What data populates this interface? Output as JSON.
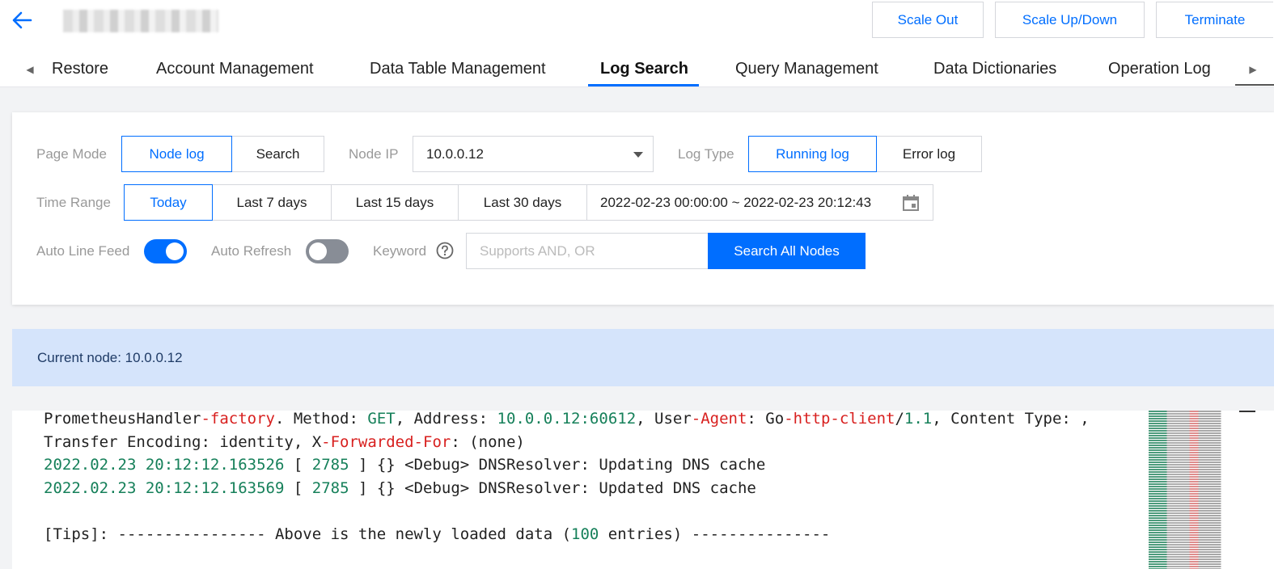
{
  "header": {
    "actions": [
      {
        "label": "Scale Out"
      },
      {
        "label": "Scale Up/Down"
      },
      {
        "label": "Terminate"
      }
    ],
    "tabs": [
      {
        "label": "Restore"
      },
      {
        "label": "Account Management"
      },
      {
        "label": "Data Table Management"
      },
      {
        "label": "Log Search",
        "active": true
      },
      {
        "label": "Query Management"
      },
      {
        "label": "Data Dictionaries"
      },
      {
        "label": "Operation Log"
      }
    ]
  },
  "filters": {
    "page_mode": {
      "label": "Page Mode",
      "options": [
        "Node log",
        "Search"
      ],
      "selected": "Node log"
    },
    "node_ip": {
      "label": "Node IP",
      "value": "10.0.0.12"
    },
    "log_type": {
      "label": "Log Type",
      "options": [
        "Running log",
        "Error log"
      ],
      "selected": "Running log"
    },
    "time_range": {
      "label": "Time Range",
      "options": [
        "Today",
        "Last 7 days",
        "Last 15 days",
        "Last 30 days"
      ],
      "selected": "Today",
      "value": "2022-02-23 00:00:00 ~ 2022-02-23 20:12:43"
    },
    "auto_line_feed": {
      "label": "Auto Line Feed",
      "on": true
    },
    "auto_refresh": {
      "label": "Auto Refresh",
      "on": false
    },
    "keyword": {
      "label": "Keyword",
      "placeholder": "Supports AND, OR",
      "value": ""
    },
    "search_button": "Search All Nodes"
  },
  "banner": {
    "text": "Current node: 10.0.0.12"
  },
  "log": {
    "line1": {
      "a": "PrometheusHandler",
      "b": "-factory",
      "c": ". Method: ",
      "d": "GET",
      "e": ", Address: ",
      "f": "10.0.0.12:60612",
      "g": ", User",
      "h": "-Agent",
      "i": ": Go",
      "j": "-http-client",
      "k": "/",
      "l": "1.1",
      "m": ", Content Type: ,"
    },
    "line2": {
      "a": "Transfer Encoding: identity, X",
      "b": "-Forwarded-For",
      "c": ": (none)"
    },
    "line3": {
      "ts": "2022.02.23 20:12:12.163526",
      "a": " [ ",
      "pid": "2785",
      "b": " ] {} <Debug> DNSResolver: Updating DNS cache"
    },
    "line4": {
      "ts": "2022.02.23 20:12:12.163569",
      "a": " [ ",
      "pid": "2785",
      "b": " ] {} <Debug> DNSResolver: Updated DNS cache"
    },
    "line6": {
      "a": "[Tips]: ---------------- Above is the newly loaded data (",
      "n": "100",
      "b": " entries) ---------------"
    }
  },
  "colors": {
    "accent": "#006eff",
    "log_red": "#d8201f",
    "log_green": "#16805a",
    "banner_bg": "#d5e4fb"
  },
  "icons": [
    "back-arrow-icon",
    "tab-scroll-left-icon",
    "tab-scroll-right-icon",
    "dropdown-caret-icon",
    "calendar-icon",
    "help-icon"
  ]
}
